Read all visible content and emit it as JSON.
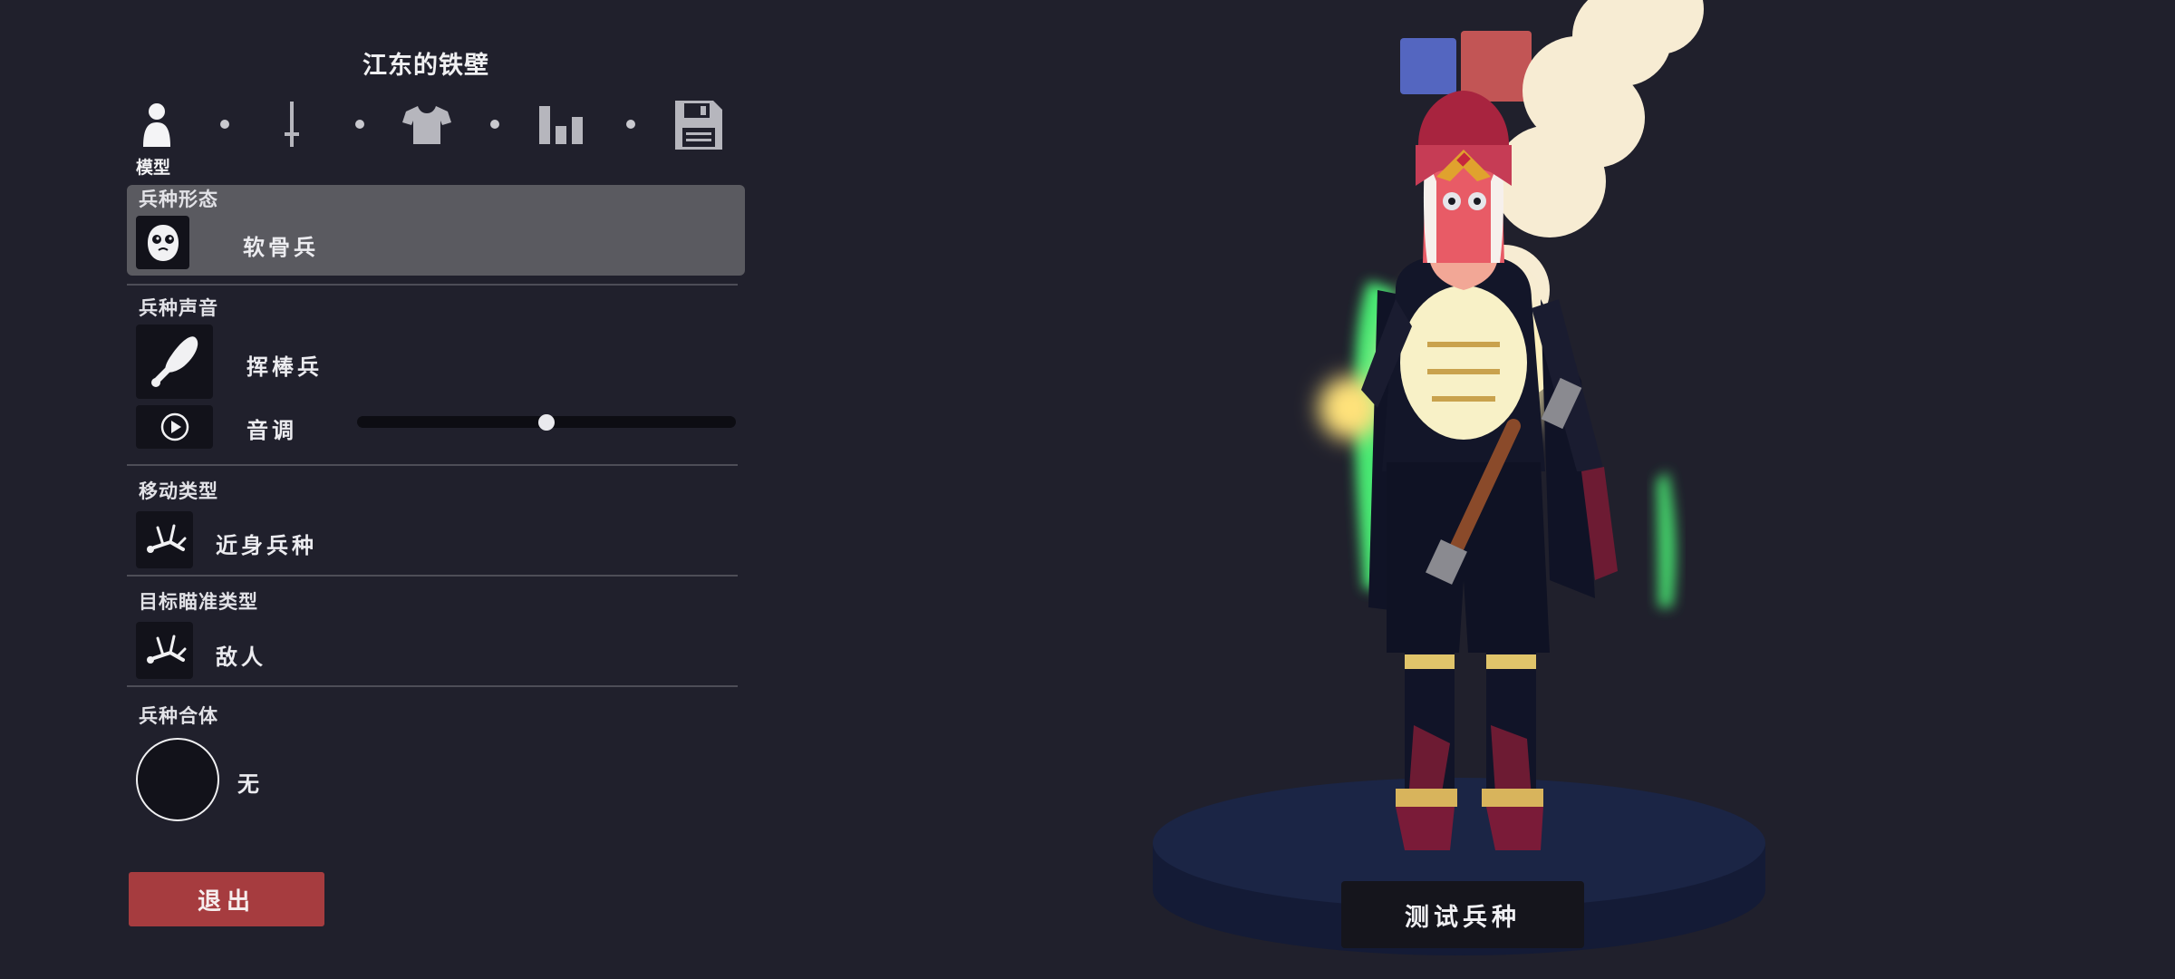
{
  "unit_name": "江东的铁壁",
  "steps": [
    {
      "icon": "person-icon",
      "label": "模型",
      "active": true
    },
    {
      "icon": "sword-icon",
      "active": false
    },
    {
      "icon": "shirt-icon",
      "active": false
    },
    {
      "icon": "stats-icon",
      "active": false
    },
    {
      "icon": "save-icon",
      "active": false
    }
  ],
  "sections": {
    "base": {
      "label": "兵种形态",
      "value": "软骨兵",
      "icon": "ghost-face-icon"
    },
    "voice": {
      "label": "兵种声音",
      "value": "挥棒兵",
      "icon": "club-icon",
      "pitch_label": "音调",
      "pitch_value": 0.5,
      "play_icon": "play-icon"
    },
    "movement": {
      "label": "移动类型",
      "value": "近身兵种",
      "icon": "stickman-icon"
    },
    "targeting": {
      "label": "目标瞄准类型",
      "value": "敌人",
      "icon": "stickman-icon"
    },
    "combine": {
      "label": "兵种合体",
      "value": "无"
    }
  },
  "exit_label": "退出",
  "test_label": "测试兵种",
  "colors": {
    "team_blue": "#5466c0",
    "team_red": "#c25555",
    "exit": "#a63c3f",
    "background": "#20202c"
  }
}
